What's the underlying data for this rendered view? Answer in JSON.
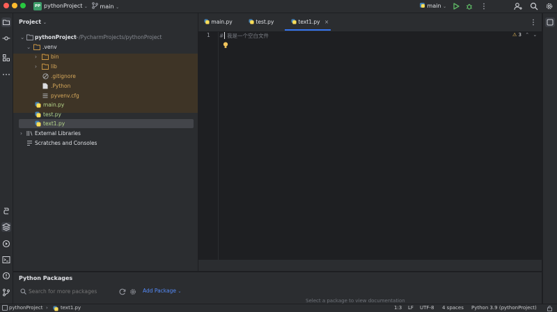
{
  "titlebar": {
    "project_badge": "PP",
    "project_name": "pythonProject",
    "branch": "main",
    "run_config": "main"
  },
  "project_panel": {
    "title": "Project",
    "root": {
      "name": "pythonProject",
      "path": "~/PycharmProjects/pythonProject"
    },
    "venv": {
      "name": ".venv",
      "children": [
        {
          "name": "bin",
          "kind": "folder"
        },
        {
          "name": "lib",
          "kind": "folder"
        },
        {
          "name": ".gitignore",
          "kind": "file"
        },
        {
          "name": ".Python",
          "kind": "file"
        },
        {
          "name": "pyvenv.cfg",
          "kind": "file"
        }
      ]
    },
    "files": [
      {
        "name": "main.py"
      },
      {
        "name": "test.py"
      },
      {
        "name": "text1.py"
      }
    ],
    "external_libraries": "External Libraries",
    "scratches": "Scratches and Consoles"
  },
  "editor": {
    "tabs": [
      {
        "label": "main.py"
      },
      {
        "label": "test.py"
      },
      {
        "label": "text1.py"
      }
    ],
    "line_number": "1",
    "code_line": "#  我是一个空白文件",
    "warning_count": "3"
  },
  "packages": {
    "title": "Python Packages",
    "search_placeholder": "Search for more packages",
    "add_package": "Add Package",
    "hint": "Select a package to view documentation"
  },
  "statusbar": {
    "project": "pythonProject",
    "file": "text1.py",
    "position": "1:3",
    "line_ending": "LF",
    "encoding": "UTF-8",
    "indent": "4 spaces",
    "interpreter": "Python 3.9 (pythonProject)"
  },
  "colors": {
    "accent": "#3574f0",
    "venv_highlight": "#3e3426",
    "python_file": "#b6d68a"
  }
}
